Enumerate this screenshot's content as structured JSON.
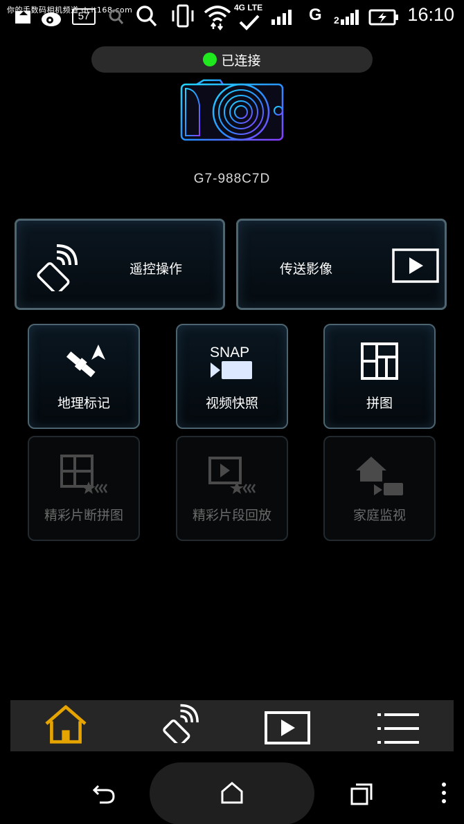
{
  "status_bar": {
    "watermark": "你的手数码相机频道 dcit168.com",
    "notification_count": "57",
    "network_label": "4G LTE",
    "carrier_letter": "G",
    "time": "16:10"
  },
  "connection": {
    "status_text": "已连接",
    "status_color": "#1fe81f"
  },
  "device": {
    "name": "G7-988C7D"
  },
  "main_buttons": {
    "remote_label": "遥控操作",
    "transfer_label": "传送影像"
  },
  "tiles": [
    {
      "label": "地理标记",
      "enabled": true
    },
    {
      "label": "视频快照",
      "enabled": true,
      "icon_text": "SNAP"
    },
    {
      "label": "拼图",
      "enabled": true
    },
    {
      "label": "精彩片断拼图",
      "enabled": false
    },
    {
      "label": "精彩片段回放",
      "enabled": false
    },
    {
      "label": "家庭监视",
      "enabled": false
    }
  ],
  "toolbar": {
    "items": [
      "home-icon",
      "remote-icon",
      "play-icon",
      "menu-icon"
    ],
    "active_color": "#e5a400"
  }
}
